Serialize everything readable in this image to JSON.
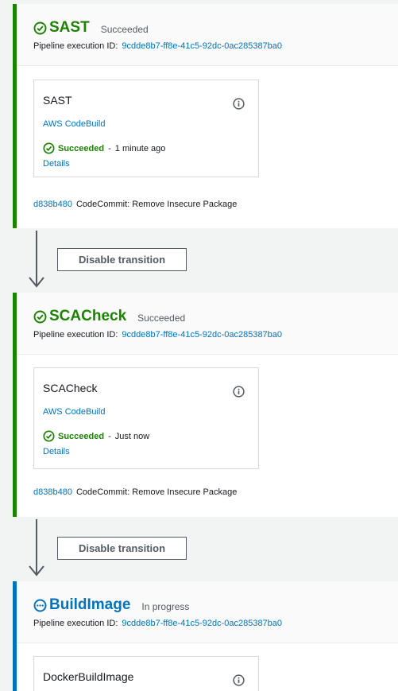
{
  "stages": [
    {
      "name": "SAST",
      "status": "Succeeded",
      "exec_label": "Pipeline execution ID:",
      "exec_id": "9cdde8b7-ff8e-41c5-92dc-0ac285387ba0",
      "icon": "check-circle-icon",
      "action": {
        "title": "SAST",
        "provider": "AWS CodeBuild",
        "status": "Succeeded",
        "separator": "-",
        "time": "1 minute ago",
        "details": "Details"
      },
      "commit_id": "d838b480",
      "commit_msg": "CodeCommit: Remove Insecure Package"
    },
    {
      "name": "SCACheck",
      "status": "Succeeded",
      "exec_label": "Pipeline execution ID:",
      "exec_id": "9cdde8b7-ff8e-41c5-92dc-0ac285387ba0",
      "icon": "check-circle-icon",
      "action": {
        "title": "SCACheck",
        "provider": "AWS CodeBuild",
        "status": "Succeeded",
        "separator": "-",
        "time": "Just now",
        "details": "Details"
      },
      "commit_id": "d838b480",
      "commit_msg": "CodeCommit: Remove Insecure Package"
    },
    {
      "name": "BuildImage",
      "status": "In progress",
      "exec_label": "Pipeline execution ID:",
      "exec_id": "9cdde8b7-ff8e-41c5-92dc-0ac285387ba0",
      "icon": "in-progress-icon",
      "action": {
        "title": "DockerBuildImage"
      }
    }
  ],
  "transitions": [
    {
      "button_label": "Disable transition"
    },
    {
      "button_label": "Disable transition"
    }
  ],
  "colors": {
    "success": "#1d8102",
    "in_progress": "#0073bb",
    "link": "#0073bb"
  }
}
